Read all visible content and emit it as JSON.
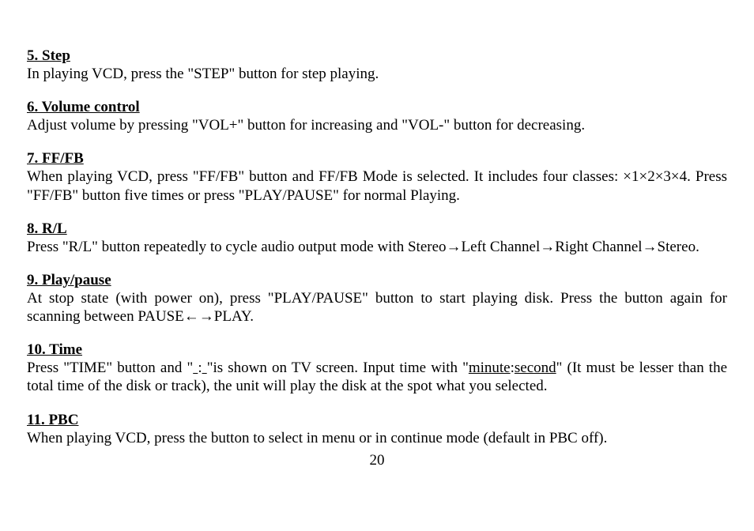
{
  "sections": [
    {
      "heading": "5. Step",
      "body": "In playing VCD, press the \"STEP\" button for step playing."
    },
    {
      "heading": "6. Volume control",
      "body": "Adjust volume by pressing \"VOL+\" button for increasing and \"VOL-\" button for decreasing."
    },
    {
      "heading": "7. FF/FB",
      "body": "When playing VCD, press \"FF/FB\" button and FF/FB Mode is selected. It includes four classes: ×1×2×3×4. Press \"FF/FB\" button five times or press \"PLAY/PAUSE\" for normal Playing."
    },
    {
      "heading": "8. R/L",
      "body": "Press \"R/L\" button repeatedly to cycle audio output mode with Stereo→Left Channel→Right Channel→Stereo."
    },
    {
      "heading": "9. Play/pause",
      "body": "At stop state (with power on), press \"PLAY/PAUSE\" button to start playing disk. Press the button again for scanning between PAUSE←→PLAY."
    },
    {
      "heading": "10. Time",
      "body_pre": "Press \"TIME\" button and \"",
      "blank1": "    ",
      "colon": ":",
      "blank2": "    ",
      "body_mid": "\"is shown on TV screen. Input time with \"",
      "minute": "minute",
      "sep": ":",
      "second": "second",
      "body_post": "\" (It must be lesser than the total time of the disk or track), the unit will play the disk at the spot what you selected."
    },
    {
      "heading": "11. PBC",
      "body": "When playing VCD, press the button to select in menu or in continue mode (default in PBC off)."
    }
  ],
  "page_number": "20"
}
